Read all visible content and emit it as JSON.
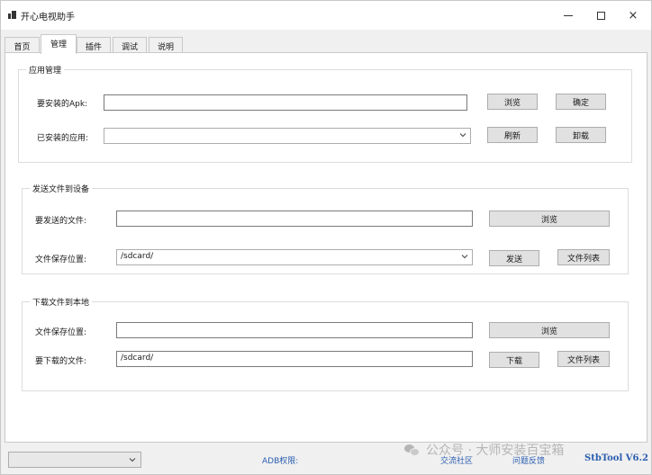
{
  "window": {
    "title": "开心电视助手",
    "minimize_label": "–",
    "close_label": "×"
  },
  "tabs": [
    {
      "label": "首页",
      "active": false
    },
    {
      "label": "管理",
      "active": true
    },
    {
      "label": "插件",
      "active": false
    },
    {
      "label": "调试",
      "active": false
    },
    {
      "label": "说明",
      "active": false
    }
  ],
  "app_management": {
    "title": "应用管理",
    "apk_label": "要安装的Apk:",
    "apk_value": "",
    "browse_label": "浏览",
    "confirm_label": "确定",
    "installed_label": "已安装的应用:",
    "installed_value": "",
    "refresh_label": "刷新",
    "uninstall_label": "卸载"
  },
  "send_file": {
    "title": "发送文件到设备",
    "file_label": "要发送的文件:",
    "file_value": "",
    "browse_label": "浏览",
    "save_location_label": "文件保存位置:",
    "save_location_value": "/sdcard/",
    "send_label": "发送",
    "file_list_label": "文件列表"
  },
  "download_file": {
    "title": "下载文件到本地",
    "save_location_label": "文件保存位置:",
    "save_location_value": "",
    "browse_label": "浏览",
    "file_label": "要下载的文件:",
    "file_value": "/sdcard/",
    "download_label": "下载",
    "file_list_label": "文件列表"
  },
  "statusbar": {
    "device_select_value": "",
    "adb_label": "ADB权限:",
    "community_link": "交流社区",
    "feedback_link": "问题反馈",
    "version": "StbTool V6.2"
  },
  "watermark": {
    "text": "公众号 · 大师安装百宝箱"
  },
  "colors": {
    "link": "#2a5db0",
    "button_bg": "#e1e1e1",
    "window_bg": "#f0f0f0"
  }
}
